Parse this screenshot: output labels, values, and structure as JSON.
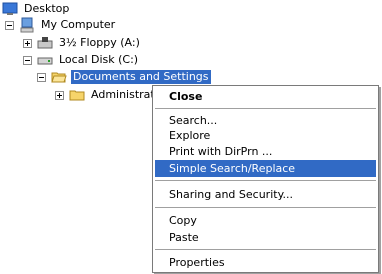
{
  "tree": {
    "desktop": "Desktop",
    "my_computer": "My Computer",
    "floppy": "3½ Floppy (A:)",
    "local_disk": "Local Disk (C:)",
    "documents": "Documents and Settings",
    "administrator": "Administrato"
  },
  "menu": {
    "close": "Close",
    "search": "Search...",
    "explore": "Explore",
    "print": "Print with DirPrn ...",
    "simple_search": "Simple Search/Replace",
    "sharing": "Sharing and Security...",
    "copy": "Copy",
    "paste": "Paste",
    "properties": "Properties"
  },
  "colors": {
    "selection": "#316ac5"
  }
}
